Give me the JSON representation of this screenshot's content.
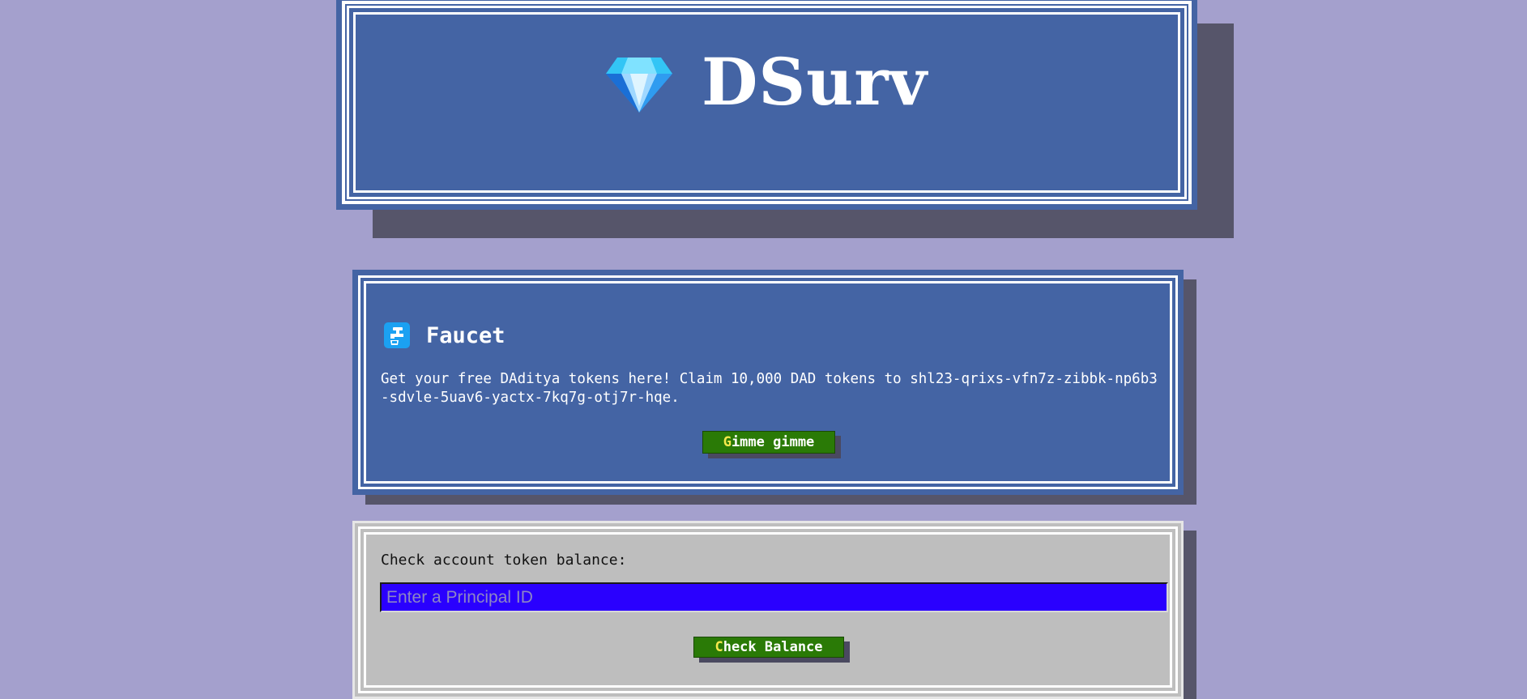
{
  "header": {
    "title": "DSurv",
    "logo_icon": "gem-stone-icon"
  },
  "faucet": {
    "icon": "potable-water-faucet-icon",
    "title": "Faucet",
    "description": "Get your free DAditya tokens here! Claim 10,000 DAD tokens to shl23-qrixs-vfn7z-zibbk-np6b3-sdvle-5uav6-yactx-7kq7g-otj7r-hqe.",
    "button_first_letter": "G",
    "button_rest": "imme gimme"
  },
  "balance": {
    "label": "Check account token balance:",
    "input_value": "",
    "input_placeholder": "Enter a Principal ID",
    "button_first_letter": "C",
    "button_rest": "heck Balance"
  },
  "colors": {
    "page_background": "#a4a0cd",
    "panel_blue": "#4464a4",
    "panel_gray": "#bebebe",
    "button_green": "#2a7a06",
    "button_accent_letter": "#f6e84b",
    "input_background": "#2a00fe",
    "shadow": "#56556a"
  }
}
